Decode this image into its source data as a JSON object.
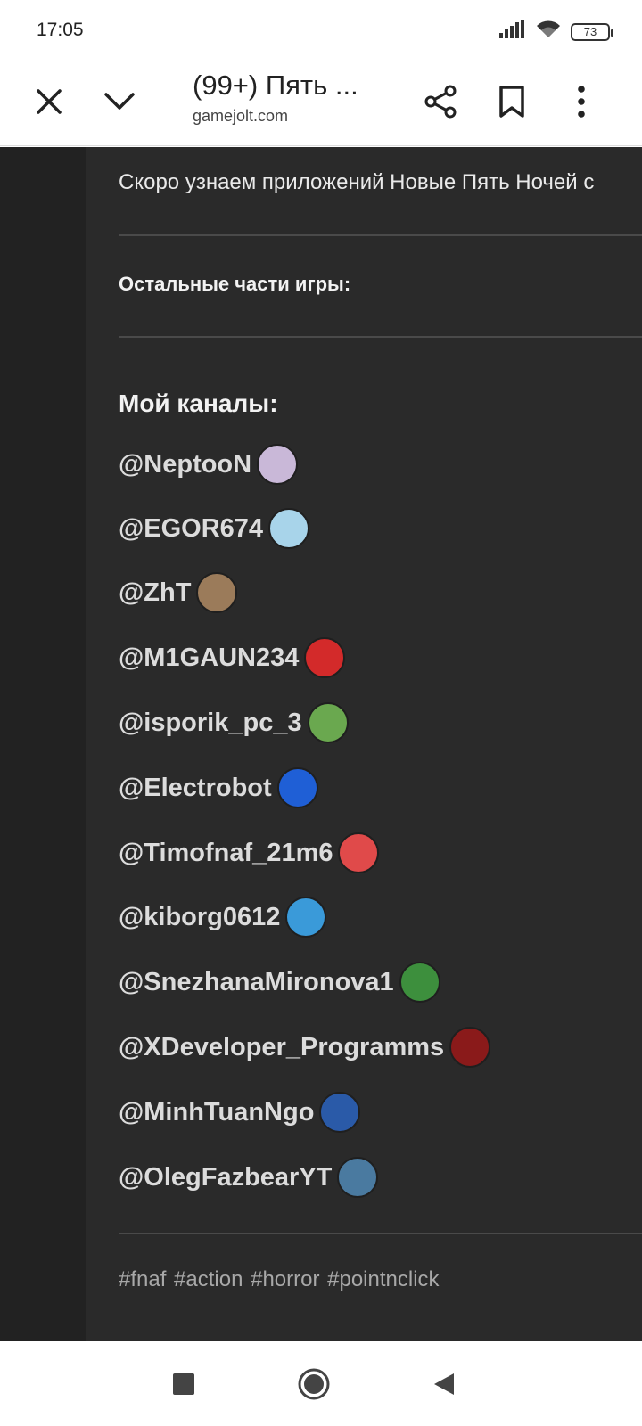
{
  "status_bar": {
    "time": "17:05",
    "battery": "73"
  },
  "toolbar": {
    "title": "(99+) Пять ...",
    "url": "gamejolt.com",
    "icons": [
      "close-icon",
      "chevron-down-icon",
      "share-icon",
      "bookmark-icon",
      "more-vert-icon"
    ]
  },
  "post": {
    "intro": "Скоро узнаем приложений Новые Пять Ночей с",
    "other_parts": "Остальные части игры:",
    "channels_title": "Мой каналы:",
    "channels": [
      {
        "name": "@NeptooN",
        "avatar_color": "#c9b8d8"
      },
      {
        "name": "@EGOR674",
        "avatar_color": "#a8d4ea"
      },
      {
        "name": "@ZhT",
        "avatar_color": "#9b7b5a"
      },
      {
        "name": "@M1GAUN234",
        "avatar_color": "#d32a2a"
      },
      {
        "name": "@isporik_pc_3",
        "avatar_color": "#6aa84f"
      },
      {
        "name": "@Electrobot",
        "avatar_color": "#1f5fd6"
      },
      {
        "name": "@Timofnaf_21m6",
        "avatar_color": "#e04a4a"
      },
      {
        "name": "@kiborg0612",
        "avatar_color": "#3a9ad9"
      },
      {
        "name": "@SnezhanaMironova1",
        "avatar_color": "#3d8f3d"
      },
      {
        "name": "@XDeveloper_Programms",
        "avatar_color": "#8a1a1a"
      },
      {
        "name": "@MinhTuanNgo",
        "avatar_color": "#2a5aa8"
      },
      {
        "name": "@OlegFazbearYT",
        "avatar_color": "#4a7aa0"
      }
    ],
    "tags": "#fnaf #action #horror #pointnclick"
  },
  "nav": {
    "icons": [
      "recents-square-icon",
      "home-circle-icon",
      "back-triangle-icon"
    ]
  }
}
